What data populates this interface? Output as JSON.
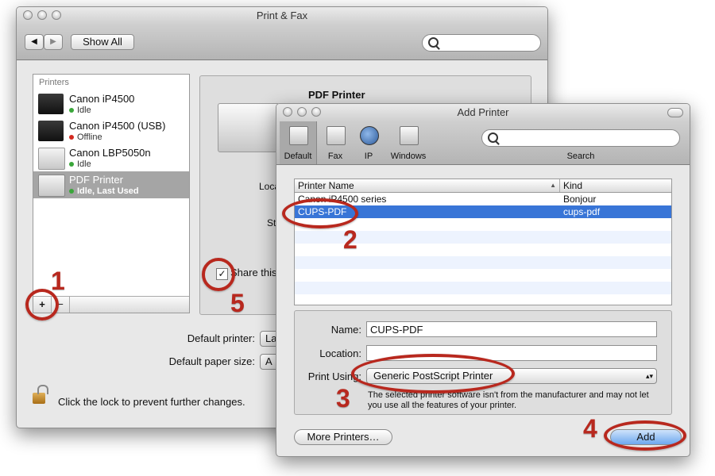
{
  "main_window": {
    "title": "Print & Fax",
    "back_glyph": "◀",
    "forward_glyph": "▶",
    "show_all_label": "Show All",
    "printers_header": "Printers",
    "printers": [
      {
        "name": "Canon iP4500",
        "status": "Idle",
        "status_color": "#3aa63a"
      },
      {
        "name": "Canon iP4500 (USB)",
        "status": "Offline",
        "status_color": "#d32a20"
      },
      {
        "name": "Canon LBP5050n",
        "status": "Idle",
        "status_color": "#3aa63a"
      },
      {
        "name": "PDF Printer",
        "status": "Idle, Last Used",
        "status_color": "#3aa63a"
      }
    ],
    "add_glyph": "+",
    "remove_glyph": "−",
    "detail_title": "PDF Printer",
    "detail_location_partial": "Loca",
    "detail_status_partial": "St",
    "share_partial": "Share this",
    "default_printer_label": "Default printer:",
    "default_printer_value_partial": "La",
    "default_paper_label": "Default paper size:",
    "default_paper_value_partial": "A",
    "lock_text": "Click the lock to prevent further changes."
  },
  "add_printer_window": {
    "title": "Add Printer",
    "toolbar": [
      {
        "label": "Default"
      },
      {
        "label": "Fax"
      },
      {
        "label": "IP"
      },
      {
        "label": "Windows"
      }
    ],
    "search_label": "Search",
    "table": {
      "col_name": "Printer Name",
      "col_kind": "Kind",
      "sort_glyph": "▲",
      "rows": [
        {
          "name": "Canon iP4500 series",
          "kind": "Bonjour"
        },
        {
          "name": "CUPS-PDF",
          "kind": "cups-pdf"
        }
      ]
    },
    "name_label": "Name:",
    "name_value": "CUPS-PDF",
    "location_label": "Location:",
    "location_value": "",
    "print_using_label": "Print Using:",
    "print_using_value": "Generic PostScript Printer",
    "stepper_glyph": "▴▾",
    "warning_text": "The selected printer software isn't from the manufacturer and may not let you use all the features of your printer.",
    "more_printers_label": "More Printers…",
    "add_label": "Add"
  },
  "annotations": [
    "1",
    "2",
    "3",
    "4",
    "5"
  ],
  "colors": {
    "selection": "#3875d7",
    "sidebar_selection": "#a5a5a5",
    "annotation_red": "#b8281e"
  }
}
